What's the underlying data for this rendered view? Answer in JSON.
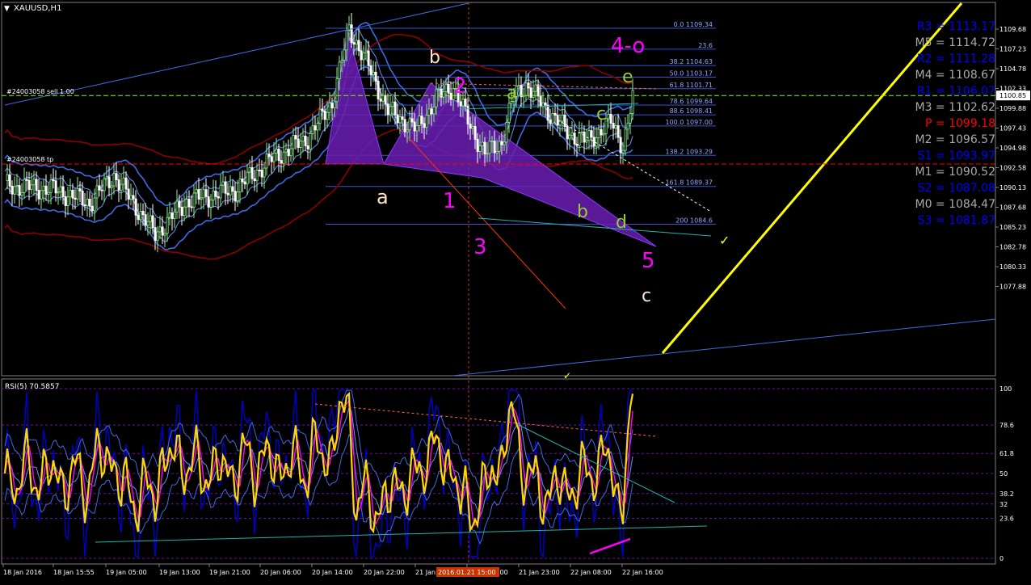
{
  "window": {
    "title": "XAUUSD,H1"
  },
  "price_pane": {
    "price_axis": [
      "1109.68",
      "1107.23",
      "1104.78",
      "1102.33",
      "1099.88",
      "1097.43",
      "1094.98",
      "1092.58",
      "1090.13",
      "1087.68",
      "1085.23",
      "1082.78",
      "1080.33",
      "1077.88"
    ],
    "current_price": "1100.85",
    "order_lines": [
      {
        "label": "#24003058 sell 1.00",
        "price": 1100.85
      },
      {
        "label": "#24003058 tp",
        "price": 1092.2
      }
    ],
    "fib_levels": [
      {
        "label": "0.0 1109.34",
        "price": 1109.34
      },
      {
        "label": "23.6",
        "price": 1106.7
      },
      {
        "label": "38.2 1104.63",
        "price": 1104.63
      },
      {
        "label": "50.0 1103.17",
        "price": 1103.17
      },
      {
        "label": "61.8 1101.71",
        "price": 1101.71
      },
      {
        "label": "78.6 1099.64",
        "price": 1099.64
      },
      {
        "label": "88.6 1098.41",
        "price": 1098.41
      },
      {
        "label": "100.0 1097.00",
        "price": 1097.0
      },
      {
        "label": "138.2 1093.29",
        "price": 1093.29
      },
      {
        "label": "161.8 1089.37",
        "price": 1089.37
      },
      {
        "label": "200 1084.6",
        "price": 1084.6
      }
    ],
    "wave_labels": [
      {
        "text": "a",
        "color": "#ffe4c4"
      },
      {
        "text": "b",
        "color": "#ffe4c4"
      },
      {
        "text": "c",
        "color": "#ffe4c4"
      },
      {
        "text": "1",
        "color": "#ff00ff"
      },
      {
        "text": "2",
        "color": "#ff00ff"
      },
      {
        "text": "3",
        "color": "#ff00ff"
      },
      {
        "text": "4-o",
        "color": "#ff00ff"
      },
      {
        "text": "5",
        "color": "#ff00ff"
      },
      {
        "text": "a",
        "color": "#9acd32"
      },
      {
        "text": "b",
        "color": "#9acd32"
      },
      {
        "text": "c",
        "color": "#9acd32"
      },
      {
        "text": "d",
        "color": "#9acd32"
      },
      {
        "text": "e",
        "color": "#9acd32"
      }
    ],
    "pivots": [
      {
        "text": "R3 = 1113.17",
        "color": "#0000ff"
      },
      {
        "text": "M5 = 1114.72",
        "color": "#a9a9a9"
      },
      {
        "text": "R2 = 1111.28",
        "color": "#0000ff"
      },
      {
        "text": "M4 = 1108.67",
        "color": "#a9a9a9"
      },
      {
        "text": "R1 = 1106.07",
        "color": "#0000ff"
      },
      {
        "text": "M3 = 1102.62",
        "color": "#a9a9a9"
      },
      {
        "text": "P = 1099.18",
        "color": "#ff0000"
      },
      {
        "text": "M2 = 1096.57",
        "color": "#a9a9a9"
      },
      {
        "text": "S1 = 1093.97",
        "color": "#0000ff"
      },
      {
        "text": "M1 = 1090.52",
        "color": "#a9a9a9"
      },
      {
        "text": "S2 = 1087.08",
        "color": "#0000ff"
      },
      {
        "text": "M0 = 1084.47",
        "color": "#a9a9a9"
      },
      {
        "text": "S3 = 1081.87",
        "color": "#0000ff"
      }
    ]
  },
  "rsi_pane": {
    "title": "RSI(5) 70.5857",
    "levels": [
      "100",
      "78.6",
      "61.8",
      "50",
      "38.2",
      "32",
      "23.6",
      "0"
    ]
  },
  "time_axis": {
    "labels": [
      "18 Jan 2016",
      "18 Jan 15:55",
      "19 Jan 05:00",
      "19 Jan 13:00",
      "19 Jan 21:00",
      "20 Jan 06:00",
      "20 Jan 14:00",
      "20 Jan 22:00",
      "21 Jan 07:00",
      "21 Jan 15:00",
      "21 Jan 23:00",
      "22 Jan 08:00",
      "22 Jan 16:00"
    ],
    "highlighted_label": "2016.01.21 15:00"
  },
  "colors": {
    "background": "#000000",
    "grid_border": "#808080",
    "bull_candle": "#90ee90",
    "bear_candle": "#ffffff",
    "envelope_blue": "#4169e1",
    "envelope_red": "#8b0000",
    "fib_line": "#3355cc",
    "pattern_fill": "#6a1fb3",
    "trend_yellow": "#ffff00",
    "rsi_line": "#ffd700"
  }
}
